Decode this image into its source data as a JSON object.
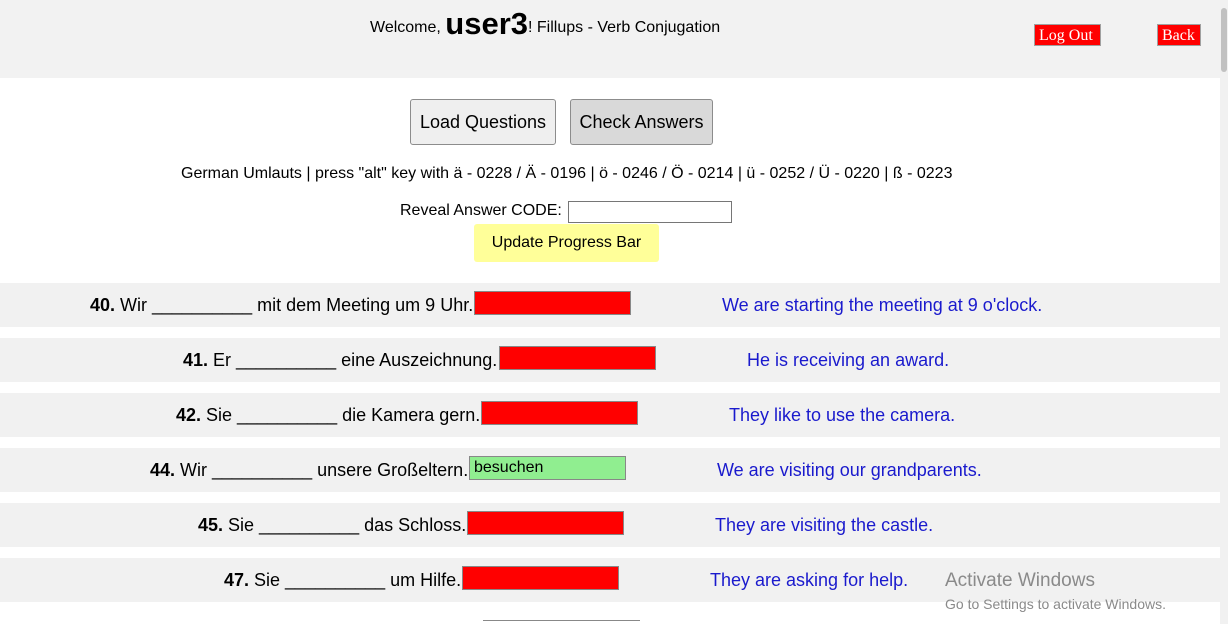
{
  "header": {
    "welcome_prefix": "Welcome, ",
    "username": "user3",
    "title_suffix": "! Fillups - Verb Conjugation",
    "logout_label": "Log Out",
    "back_label": "Back"
  },
  "controls": {
    "load_label": "Load Questions",
    "check_label": "Check Answers",
    "umlauts_text": "German Umlauts | press \"alt\" key with ä - 0228 / Ä - 0196 | ö - 0246 / Ö - 0214 | ü - 0252 / Ü - 0220 | ß - 0223",
    "reveal_label": "Reveal Answer CODE:",
    "reveal_value": "",
    "progress_label": "Update Progress Bar"
  },
  "questions": [
    {
      "num": "40.",
      "text": " Wir __________ mit dem Meeting um 9 Uhr.",
      "answer": "",
      "status": "wrong",
      "translation": "We are starting the meeting at 9 o'clock."
    },
    {
      "num": "41.",
      "text": " Er __________ eine Auszeichnung.",
      "answer": "",
      "status": "wrong",
      "translation": "He is receiving an award."
    },
    {
      "num": "42.",
      "text": " Sie __________ die Kamera gern.",
      "answer": "",
      "status": "wrong",
      "translation": "They like to use the camera."
    },
    {
      "num": "44.",
      "text": " Wir __________ unsere Großeltern.",
      "answer": "besuchen",
      "status": "correct",
      "translation": "We are visiting our grandparents."
    },
    {
      "num": "45.",
      "text": " Sie __________ das Schloss.",
      "answer": "",
      "status": "wrong",
      "translation": "They are visiting the castle."
    },
    {
      "num": "47.",
      "text": " Sie __________ um Hilfe.",
      "answer": "",
      "status": "wrong",
      "translation": "They are asking for help."
    }
  ],
  "colors": {
    "wrong": "#ff0000",
    "correct": "#90ee90",
    "translation": "#1a1acd",
    "progress_button": "#ffff99"
  },
  "watermark": {
    "line1": "Activate Windows",
    "line2": "Go to Settings to activate Windows."
  }
}
